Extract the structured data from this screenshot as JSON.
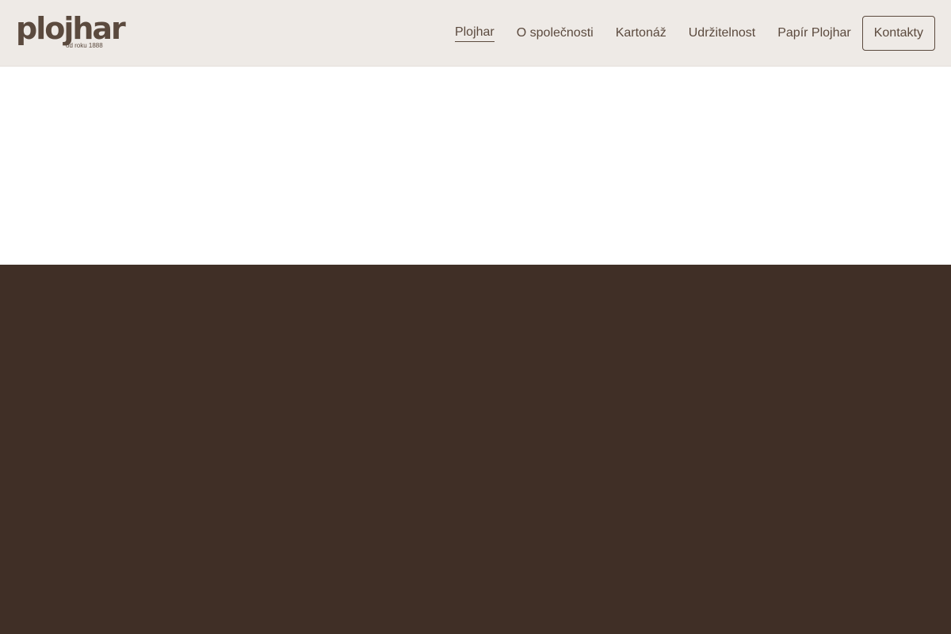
{
  "header": {
    "logo": {
      "word": "plojhar",
      "tagline": "od roku 1888"
    },
    "nav": {
      "items": [
        {
          "label": "Plojhar",
          "active": true
        },
        {
          "label": "O společnosti",
          "active": false
        },
        {
          "label": "Kartonáž",
          "active": false
        },
        {
          "label": "Udržitelnost",
          "active": false
        },
        {
          "label": "Papír Plojhar",
          "active": false
        }
      ],
      "contact_button": "Kontakty"
    }
  },
  "colors": {
    "header_bg": "#eeeae6",
    "brand_text": "#5b4a3e",
    "dark_section_bg": "#402f26",
    "page_bg": "#ffffff"
  }
}
